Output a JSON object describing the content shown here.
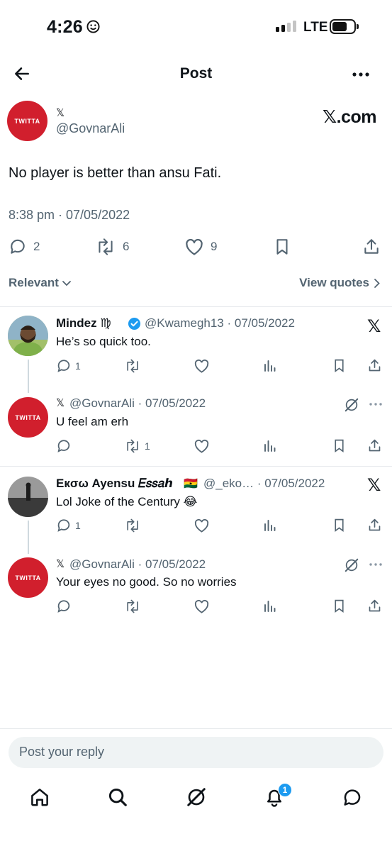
{
  "status_bar": {
    "time": "4:26",
    "network": "LTE"
  },
  "header": {
    "title": "Post"
  },
  "post": {
    "avatar_text": "TWITTA",
    "name": "𝕏",
    "handle": "@GovnarAli",
    "brand": "𝕏.com",
    "text": "No player is better than ansu Fati.",
    "time": "8:38 pm · 07/05/2022",
    "stats": {
      "replies": "2",
      "reposts": "6",
      "likes": "9"
    }
  },
  "sort": {
    "label": "Relevant",
    "view_quotes": "View quotes"
  },
  "replies": [
    {
      "name": "Mindez ♍",
      "handle_date": "@Kwamegh13 · 07/05/2022",
      "text": "He’s so quick too.",
      "reply_count": "1",
      "repost_count": "",
      "sub": {
        "avatar_text": "TWITTA",
        "name": "𝕏",
        "handle_date": "@GovnarAli · 07/05/2022",
        "text": "U feel am erh",
        "reply_count": "",
        "repost_count": "1"
      }
    },
    {
      "name": "Eкσω Ayensu 𝐸𝑠𝑠𝑎ℎ",
      "flag": "🇬🇭",
      "handle_date": "@_eko… · 07/05/2022",
      "text": "Lol Joke of the Century 😂",
      "reply_count": "1",
      "repost_count": "",
      "sub": {
        "avatar_text": "TWITTA",
        "name": "𝕏",
        "handle_date": "@GovnarAli · 07/05/2022",
        "text": "Your eyes no good. So no worries",
        "reply_count": "",
        "repost_count": ""
      }
    }
  ],
  "composer": {
    "placeholder": "Post your reply"
  },
  "bottom_nav": {
    "notification_count": "1"
  },
  "colors": {
    "brand_red": "#d11f2d",
    "accent_blue": "#1d9bf0",
    "muted": "#536471"
  }
}
